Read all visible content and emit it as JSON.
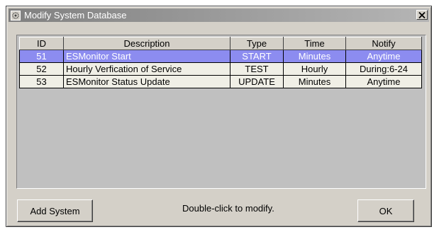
{
  "window": {
    "title": "Modify System Database"
  },
  "table": {
    "columns": [
      "ID",
      "Description",
      "Type",
      "Time",
      "Notify"
    ],
    "rows": [
      {
        "id": "51",
        "description": "ESMonitor Start",
        "type": "START",
        "time": "Minutes",
        "notify": "Anytime",
        "selected": true
      },
      {
        "id": "52",
        "description": "Hourly Verfication of Service",
        "type": "TEST",
        "time": "Hourly",
        "notify": "During:6-24",
        "selected": false
      },
      {
        "id": "53",
        "description": "ESMonitor Status Update",
        "type": "UPDATE",
        "time": "Minutes",
        "notify": "Anytime",
        "selected": false
      }
    ]
  },
  "footer": {
    "add_label": "Add System",
    "hint": "Double-click to modify.",
    "ok_label": "OK"
  },
  "colors": {
    "selected_row": "#8c8cf0",
    "row_background": "#f0efe6",
    "dialog_face": "#d4d0c8"
  }
}
